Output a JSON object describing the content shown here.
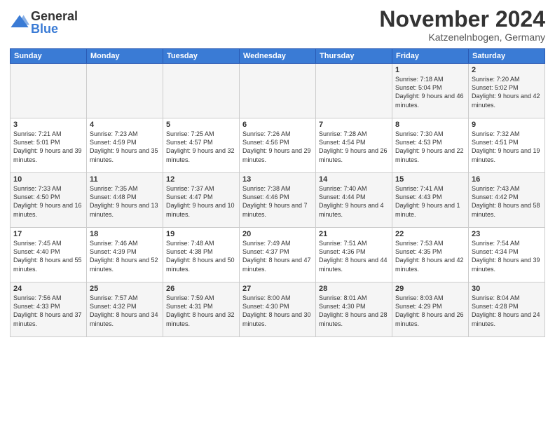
{
  "header": {
    "logo_general": "General",
    "logo_blue": "Blue",
    "month_title": "November 2024",
    "location": "Katzenelnbogen, Germany"
  },
  "weekdays": [
    "Sunday",
    "Monday",
    "Tuesday",
    "Wednesday",
    "Thursday",
    "Friday",
    "Saturday"
  ],
  "weeks": [
    [
      {
        "day": "",
        "info": ""
      },
      {
        "day": "",
        "info": ""
      },
      {
        "day": "",
        "info": ""
      },
      {
        "day": "",
        "info": ""
      },
      {
        "day": "",
        "info": ""
      },
      {
        "day": "1",
        "info": "Sunrise: 7:18 AM\nSunset: 5:04 PM\nDaylight: 9 hours and 46 minutes."
      },
      {
        "day": "2",
        "info": "Sunrise: 7:20 AM\nSunset: 5:02 PM\nDaylight: 9 hours and 42 minutes."
      }
    ],
    [
      {
        "day": "3",
        "info": "Sunrise: 7:21 AM\nSunset: 5:01 PM\nDaylight: 9 hours and 39 minutes."
      },
      {
        "day": "4",
        "info": "Sunrise: 7:23 AM\nSunset: 4:59 PM\nDaylight: 9 hours and 35 minutes."
      },
      {
        "day": "5",
        "info": "Sunrise: 7:25 AM\nSunset: 4:57 PM\nDaylight: 9 hours and 32 minutes."
      },
      {
        "day": "6",
        "info": "Sunrise: 7:26 AM\nSunset: 4:56 PM\nDaylight: 9 hours and 29 minutes."
      },
      {
        "day": "7",
        "info": "Sunrise: 7:28 AM\nSunset: 4:54 PM\nDaylight: 9 hours and 26 minutes."
      },
      {
        "day": "8",
        "info": "Sunrise: 7:30 AM\nSunset: 4:53 PM\nDaylight: 9 hours and 22 minutes."
      },
      {
        "day": "9",
        "info": "Sunrise: 7:32 AM\nSunset: 4:51 PM\nDaylight: 9 hours and 19 minutes."
      }
    ],
    [
      {
        "day": "10",
        "info": "Sunrise: 7:33 AM\nSunset: 4:50 PM\nDaylight: 9 hours and 16 minutes."
      },
      {
        "day": "11",
        "info": "Sunrise: 7:35 AM\nSunset: 4:48 PM\nDaylight: 9 hours and 13 minutes."
      },
      {
        "day": "12",
        "info": "Sunrise: 7:37 AM\nSunset: 4:47 PM\nDaylight: 9 hours and 10 minutes."
      },
      {
        "day": "13",
        "info": "Sunrise: 7:38 AM\nSunset: 4:46 PM\nDaylight: 9 hours and 7 minutes."
      },
      {
        "day": "14",
        "info": "Sunrise: 7:40 AM\nSunset: 4:44 PM\nDaylight: 9 hours and 4 minutes."
      },
      {
        "day": "15",
        "info": "Sunrise: 7:41 AM\nSunset: 4:43 PM\nDaylight: 9 hours and 1 minute."
      },
      {
        "day": "16",
        "info": "Sunrise: 7:43 AM\nSunset: 4:42 PM\nDaylight: 8 hours and 58 minutes."
      }
    ],
    [
      {
        "day": "17",
        "info": "Sunrise: 7:45 AM\nSunset: 4:40 PM\nDaylight: 8 hours and 55 minutes."
      },
      {
        "day": "18",
        "info": "Sunrise: 7:46 AM\nSunset: 4:39 PM\nDaylight: 8 hours and 52 minutes."
      },
      {
        "day": "19",
        "info": "Sunrise: 7:48 AM\nSunset: 4:38 PM\nDaylight: 8 hours and 50 minutes."
      },
      {
        "day": "20",
        "info": "Sunrise: 7:49 AM\nSunset: 4:37 PM\nDaylight: 8 hours and 47 minutes."
      },
      {
        "day": "21",
        "info": "Sunrise: 7:51 AM\nSunset: 4:36 PM\nDaylight: 8 hours and 44 minutes."
      },
      {
        "day": "22",
        "info": "Sunrise: 7:53 AM\nSunset: 4:35 PM\nDaylight: 8 hours and 42 minutes."
      },
      {
        "day": "23",
        "info": "Sunrise: 7:54 AM\nSunset: 4:34 PM\nDaylight: 8 hours and 39 minutes."
      }
    ],
    [
      {
        "day": "24",
        "info": "Sunrise: 7:56 AM\nSunset: 4:33 PM\nDaylight: 8 hours and 37 minutes."
      },
      {
        "day": "25",
        "info": "Sunrise: 7:57 AM\nSunset: 4:32 PM\nDaylight: 8 hours and 34 minutes."
      },
      {
        "day": "26",
        "info": "Sunrise: 7:59 AM\nSunset: 4:31 PM\nDaylight: 8 hours and 32 minutes."
      },
      {
        "day": "27",
        "info": "Sunrise: 8:00 AM\nSunset: 4:30 PM\nDaylight: 8 hours and 30 minutes."
      },
      {
        "day": "28",
        "info": "Sunrise: 8:01 AM\nSunset: 4:30 PM\nDaylight: 8 hours and 28 minutes."
      },
      {
        "day": "29",
        "info": "Sunrise: 8:03 AM\nSunset: 4:29 PM\nDaylight: 8 hours and 26 minutes."
      },
      {
        "day": "30",
        "info": "Sunrise: 8:04 AM\nSunset: 4:28 PM\nDaylight: 8 hours and 24 minutes."
      }
    ]
  ]
}
